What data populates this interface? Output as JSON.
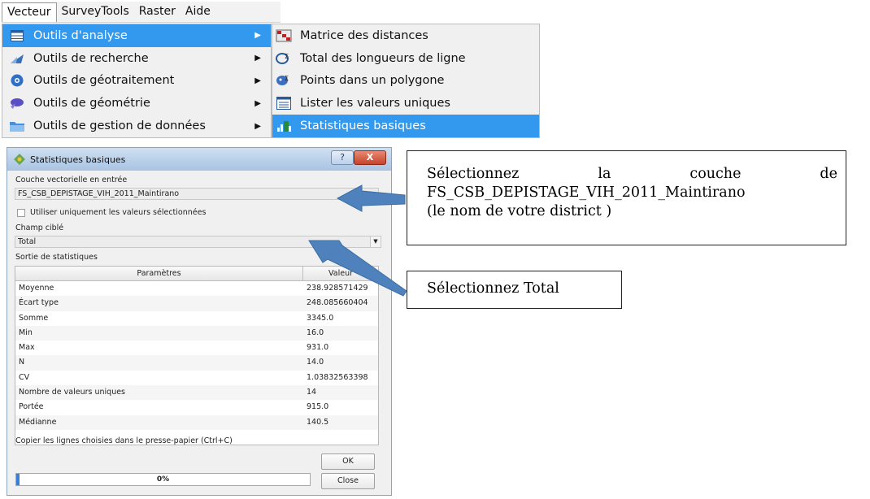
{
  "menubar": {
    "items": [
      "Vecteur",
      "SurveyTools",
      "Raster",
      "Aide"
    ]
  },
  "menu_main": {
    "items": [
      {
        "label": "Outils d'analyse"
      },
      {
        "label": "Outils de recherche"
      },
      {
        "label": "Outils de géotraitement"
      },
      {
        "label": "Outils de géométrie"
      },
      {
        "label": "Outils de gestion de données"
      }
    ],
    "highlighted_index": 0
  },
  "menu_sub": {
    "items": [
      {
        "label": "Matrice des distances"
      },
      {
        "label": "Total des longueurs de ligne"
      },
      {
        "label": "Points dans un polygone"
      },
      {
        "label": "Lister les valeurs uniques"
      },
      {
        "label": "Statistiques basiques"
      }
    ],
    "highlighted_index": 4
  },
  "dialog": {
    "title": "Statistiques basiques",
    "help_label": "?",
    "close_glyph": "X",
    "input_layer_label": "Couche vectorielle en entrée",
    "input_layer_value": "FS_CSB_DEPISTAGE_VIH_2011_Maintirano",
    "selected_only_label": "Utiliser uniquement les valeurs sélectionnées",
    "target_field_label": "Champ ciblé",
    "target_field_value": "Total",
    "output_label": "Sortie de statistiques",
    "table": {
      "headers": [
        "Paramètres",
        "Valeur"
      ],
      "rows": [
        [
          "Moyenne",
          "238.928571429"
        ],
        [
          "Écart type",
          "248.085660404"
        ],
        [
          "Somme",
          "3345.0"
        ],
        [
          "Min",
          "16.0"
        ],
        [
          "Max",
          "931.0"
        ],
        [
          "N",
          "14.0"
        ],
        [
          "CV",
          "1.03832563398"
        ],
        [
          "Nombre de valeurs uniques",
          "14"
        ],
        [
          "Portée",
          "915.0"
        ],
        [
          "Médianne",
          "140.5"
        ]
      ]
    },
    "copy_hint": "Copier les lignes choisies dans le presse-papier (Ctrl+C)",
    "ok_label": "OK",
    "close_label": "Close",
    "progress_text": "0%",
    "progress_fraction": 0.01
  },
  "callouts": {
    "layer_line1": [
      "Sélectionnez",
      "la",
      "couche",
      "de"
    ],
    "layer_line2": "FS_CSB_DEPISTAGE_VIH_2011_Maintirano",
    "layer_line3": "(le nom de votre district )",
    "field": "Sélectionnez Total",
    "arrow_color": "#4f81bd"
  },
  "colors": {
    "menu_highlight": "#3399ee",
    "progress_fill": "#3b7fd4"
  }
}
